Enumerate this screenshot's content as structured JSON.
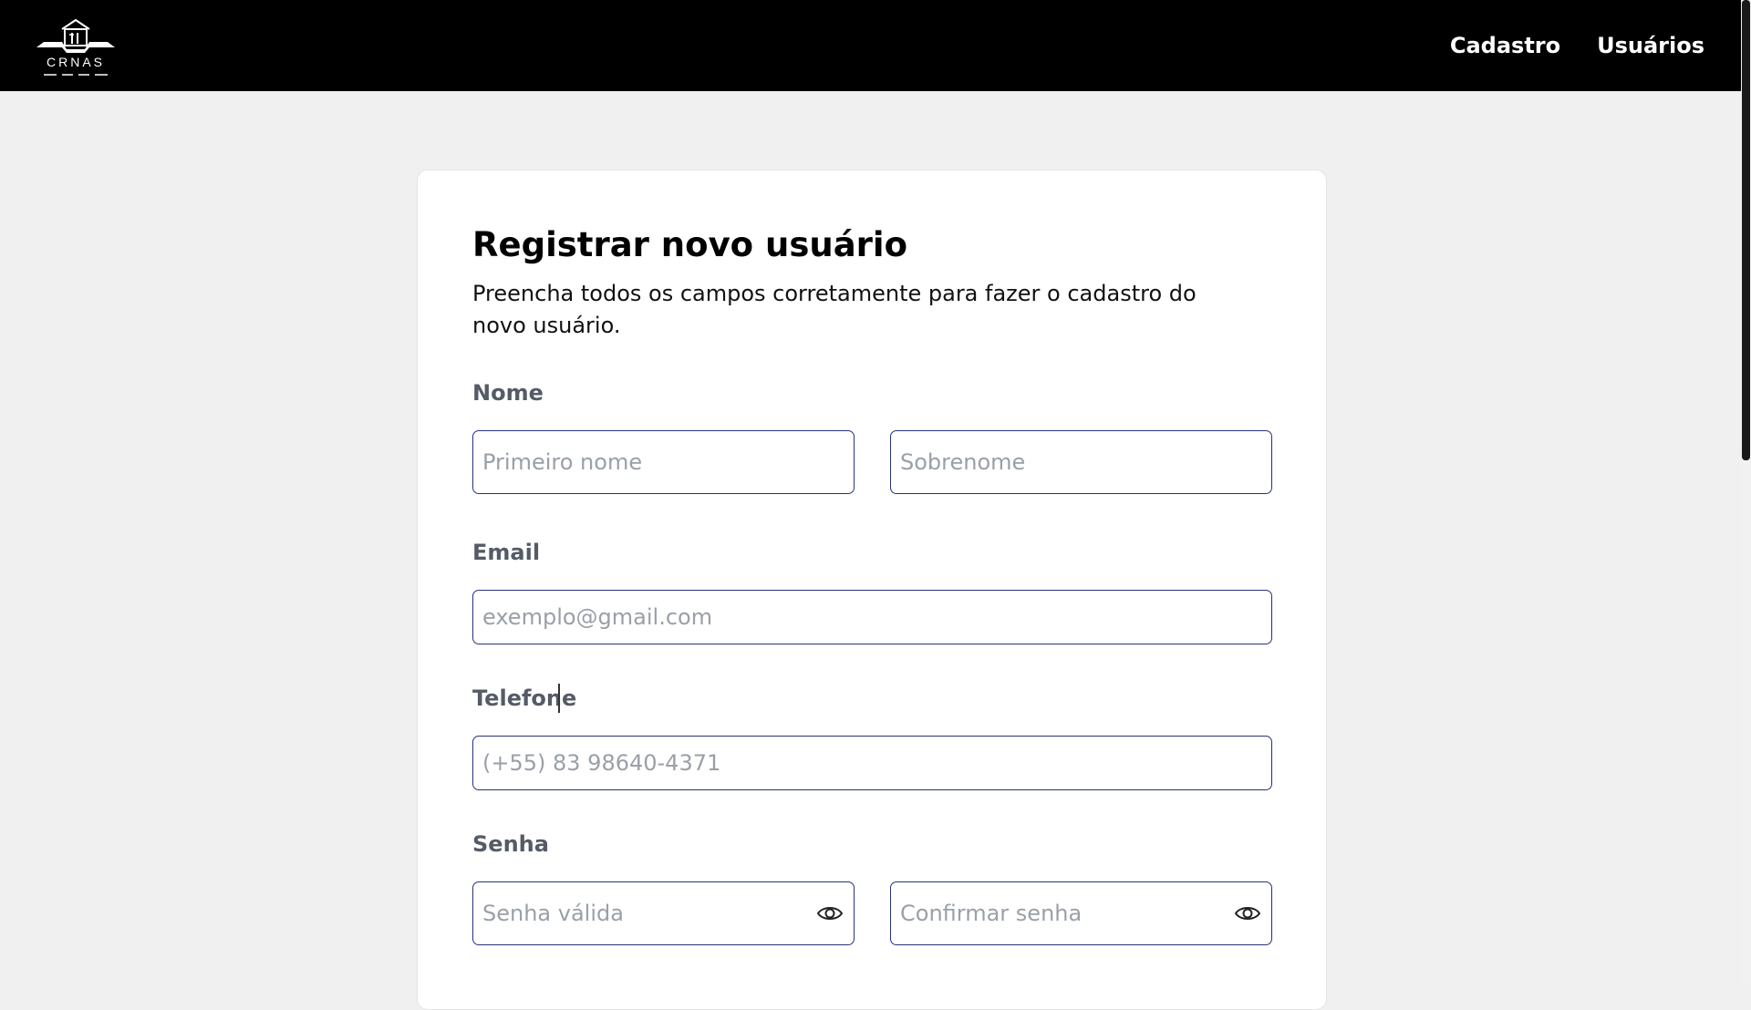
{
  "navbar": {
    "logo_text": "CRNAS",
    "links": [
      "Cadastro",
      "Usuários"
    ]
  },
  "form": {
    "title": "Registrar novo usuário",
    "subtitle": "Preencha todos os campos corretamente para fazer o cadastro do novo usuário.",
    "name_label": "Nome",
    "first_name_placeholder": "Primeiro nome",
    "last_name_placeholder": "Sobrenome",
    "email_label": "Email",
    "email_placeholder": "exemplo@gmail.com",
    "phone_label": "Telefone",
    "phone_placeholder": "(+55) 83 98640-4371",
    "password_label": "Senha",
    "password_placeholder": "Senha válida",
    "confirm_password_placeholder": "Confirmar senha"
  },
  "icons": {
    "logo": "ship-logo-icon",
    "password_toggle": "eye-icon",
    "confirm_toggle": "eye-icon"
  },
  "colors": {
    "navbar": "#000000",
    "input_border": "#26337a",
    "label": "#555b66"
  }
}
